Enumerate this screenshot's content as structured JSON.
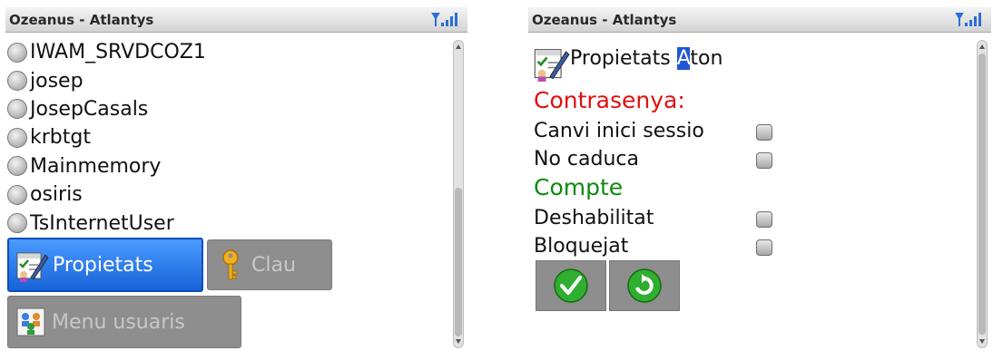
{
  "left_screen": {
    "title": "Ozeanus - Atlantys",
    "signal_icon": "signal-strength-icon",
    "users": [
      {
        "label": "IWAM_SRVDCOZ1"
      },
      {
        "label": "josep"
      },
      {
        "label": "JosepCasals"
      },
      {
        "label": "krbtgt"
      },
      {
        "label": "Mainmemory"
      },
      {
        "label": "osiris"
      },
      {
        "label": "TsInternetUser"
      }
    ],
    "actions": {
      "properties": {
        "label": "Propietats",
        "icon": "properties-icon",
        "state": "selected"
      },
      "key": {
        "label": "Clau",
        "icon": "key-icon",
        "state": "disabled"
      },
      "users_menu": {
        "label": "Menu usuaris",
        "icon": "users-menu-icon",
        "state": "disabled"
      }
    }
  },
  "right_screen": {
    "title": "Ozeanus - Atlantys",
    "signal_icon": "signal-strength-icon",
    "header": {
      "prefix": "Propietats ",
      "cursor_char": "A",
      "suffix": "ton"
    },
    "password_section": {
      "label": "Contrasenya:",
      "color": "#e0100e"
    },
    "password_fields": [
      {
        "label": "Canvi inici sessio",
        "checked": false
      },
      {
        "label": "No caduca",
        "checked": false
      }
    ],
    "account_section": {
      "label": "Compte",
      "color": "#0f8a0f"
    },
    "account_fields": [
      {
        "label": "Deshabilitat",
        "checked": false
      },
      {
        "label": "Bloquejat",
        "checked": false
      }
    ],
    "buttons": [
      {
        "icon": "checkmark-icon"
      },
      {
        "icon": "refresh-icon"
      }
    ]
  },
  "colors": {
    "selection_blue": "#1763d9",
    "disabled_gray": "#8e8e8e"
  }
}
